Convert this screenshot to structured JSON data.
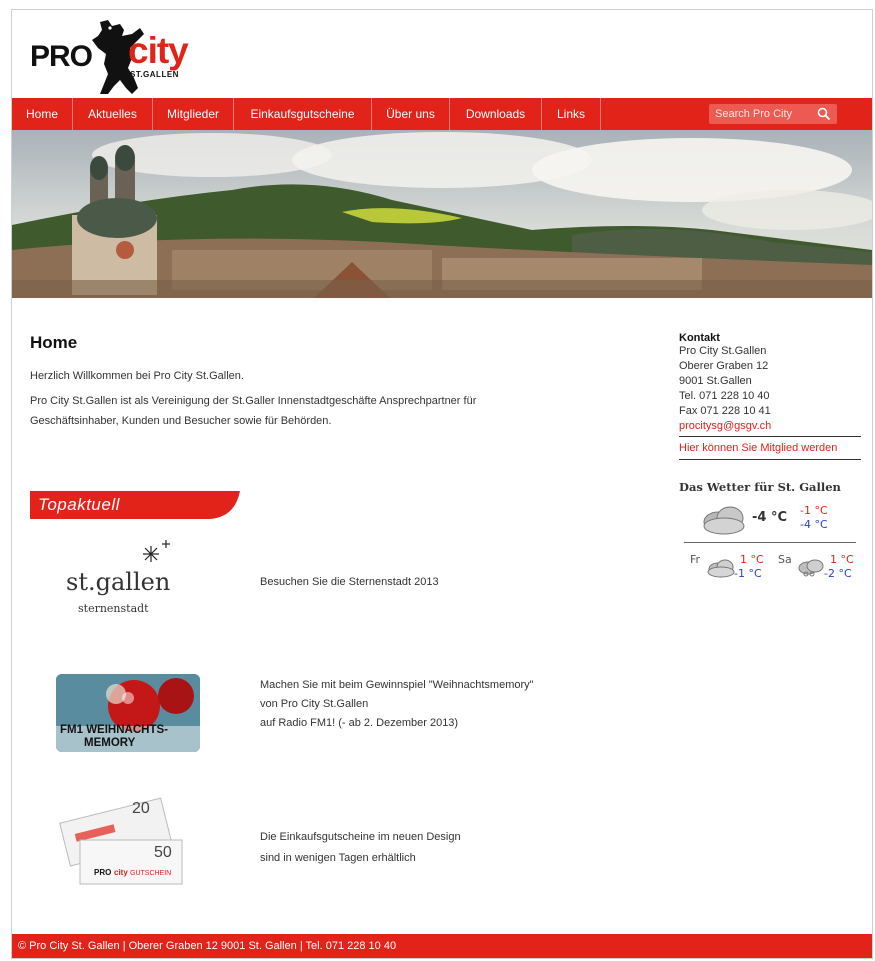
{
  "logo": {
    "pro": "PRO",
    "city": "city",
    "subtitle": "ST.GALLEN"
  },
  "nav": {
    "items": [
      "Home",
      "Aktuelles",
      "Mitglieder",
      "Einkaufsgutscheine",
      "Über uns",
      "Downloads",
      "Links"
    ],
    "search_placeholder": "Search Pro City"
  },
  "main": {
    "title": "Home",
    "paragraphs": [
      "Herzlich Willkommen bei Pro City St.Gallen.",
      "Pro City St.Gallen ist als Vereinigung der St.Galler Innenstadtgeschäfte Ansprechpartner für",
      "Geschäftsinhaber, Kunden und Besucher sowie für Behörden."
    ],
    "topaktuell_label": "Topaktuell",
    "news": [
      {
        "image_text": {
          "brand": "st.gallen",
          "sub": "sternenstadt"
        },
        "lines": [
          "Besuchen Sie die Sternenstadt 2013"
        ]
      },
      {
        "image_text": {
          "line1": "FM1 WEIHNACHTS-",
          "line2": "MEMORY"
        },
        "lines": [
          "Machen Sie mit beim Gewinnspiel \"Weihnachtsmemory\"",
          "von Pro City St.Gallen",
          "auf Radio FM1! (- ab 2. Dezember 2013)"
        ]
      },
      {
        "image_text": {
          "v20": "20",
          "v50": "50"
        },
        "lines": [
          "Die Einkaufsgutscheine im neuen Design",
          "sind in wenigen Tagen erhältlich"
        ]
      }
    ]
  },
  "sidebar": {
    "contact_title": "Kontakt",
    "contact_lines": [
      "Pro City St.Gallen",
      "Oberer Graben 12",
      "9001 St.Gallen",
      "Tel. 071 228 10 40",
      "Fax 071 228 10 41"
    ],
    "email": "procitysg@gsgv.ch",
    "member_link": "Hier können Sie Mitglied werden"
  },
  "weather": {
    "title": "Das Wetter für St. Gallen",
    "current_temp": "-4 °C",
    "current_high": "-1 °C",
    "current_low": "-4 °C",
    "forecast": [
      {
        "day": "Fr",
        "high": "1 °C",
        "low": "-1 °C"
      },
      {
        "day": "Sa",
        "high": "1 °C",
        "low": "-2 °C"
      }
    ],
    "colors": {
      "high": "#e2231a",
      "low": "#2b3fc6"
    }
  },
  "footer": {
    "text": "© Pro City St. Gallen | Oberer Graben 12 9001 St. Gallen | Tel. 071 228 10 40"
  },
  "colors": {
    "brand_red": "#e2231a"
  }
}
